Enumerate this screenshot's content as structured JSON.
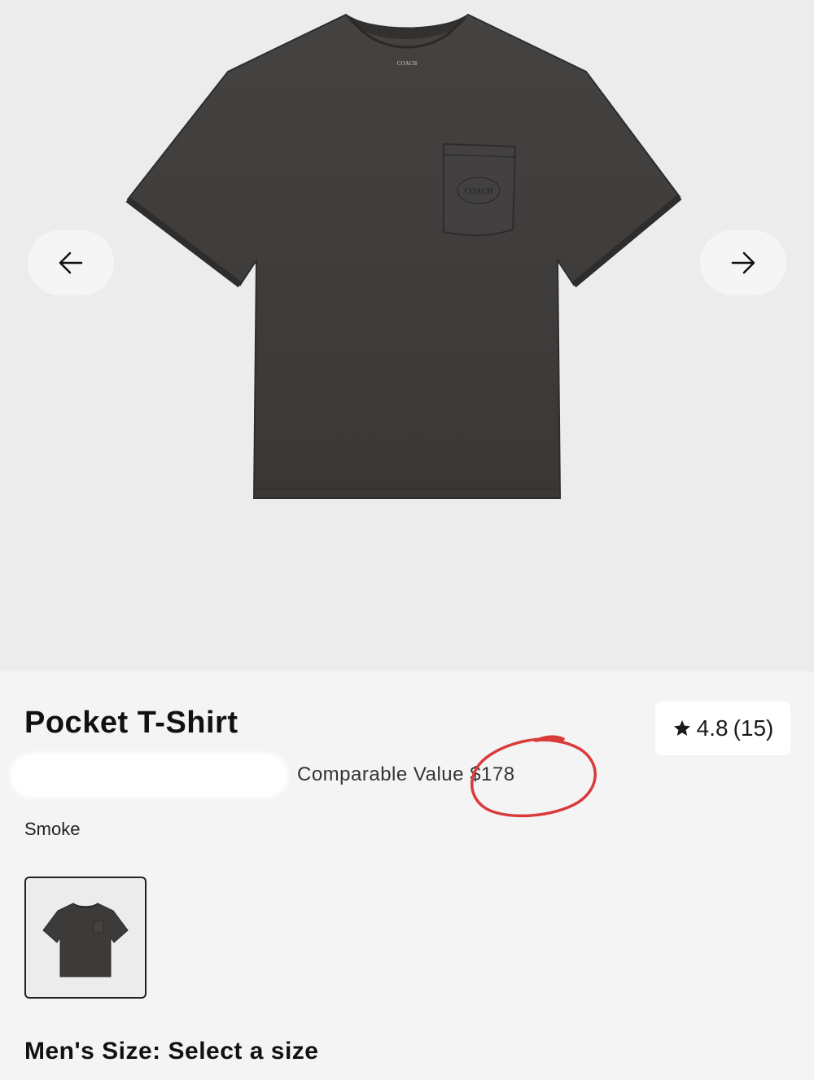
{
  "product": {
    "title": "Pocket T-Shirt",
    "rating_value": "4.8",
    "rating_count": "(15)",
    "comparable_value_label": "Comparable Value",
    "comparable_value_price": "$178",
    "color_name": "Smoke",
    "size_label": "Men's Size:",
    "size_value": "Select a size",
    "garment_color": "#3d3b39",
    "neck_logo_text": "COACH",
    "pocket_logo_text": "COACH"
  },
  "gallery": {
    "prev_icon": "arrow-left-icon",
    "next_icon": "arrow-right-icon"
  },
  "annotation": {
    "color": "#d93a3a",
    "shape": "hand-drawn circle around price"
  }
}
